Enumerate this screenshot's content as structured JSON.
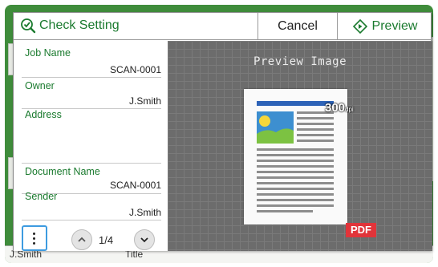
{
  "background": {
    "owner_text": "J.Smith",
    "title_text": "Title"
  },
  "dialog": {
    "title": "Check Setting",
    "cancel_label": "Cancel",
    "preview_label": "Preview",
    "accent_color": "#1a7a2e"
  },
  "info": {
    "job_name_label": "Job Name",
    "job_name_value": "SCAN-0001",
    "owner_label": "Owner",
    "owner_value": "J.Smith",
    "address_label": "Address",
    "document_name_label": "Document Name",
    "document_name_value": "SCAN-0001",
    "sender_label": "Sender",
    "sender_value": "J.Smith"
  },
  "pager": {
    "page_indicator": "1/4"
  },
  "preview": {
    "title": "Preview Image",
    "resolution_value": "300",
    "resolution_unit": "dpi",
    "format_badge": "PDF"
  },
  "icons": [
    "check-setting-icon",
    "preview-diamond-icon",
    "menu-dots-icon",
    "chevron-up-icon",
    "chevron-down-icon"
  ]
}
